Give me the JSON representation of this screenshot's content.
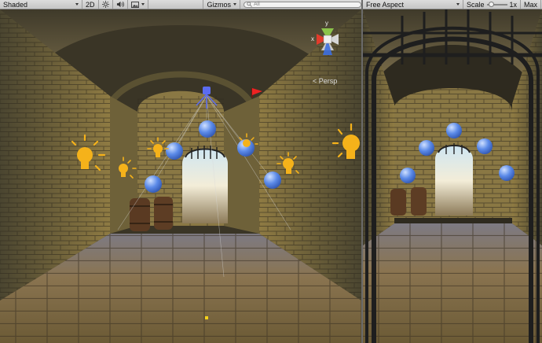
{
  "scene_toolbar": {
    "shading_mode": "Shaded",
    "mode_2d": "2D",
    "light_icon": "sun-icon",
    "audio_icon": "speaker-icon",
    "effects_icon": "image-icon",
    "gizmos_label": "Gizmos",
    "search_placeholder": "All"
  },
  "scene_view": {
    "projection_label": "< Persp",
    "gizmo_axes": {
      "x": "x",
      "y": "y"
    }
  },
  "game_toolbar": {
    "aspect": "Free Aspect",
    "scale_label": "Scale",
    "scale_value": "1x",
    "maximize_label": "Max"
  },
  "colors": {
    "toolbar_bg": "#d4d4d4",
    "light_icon": "#f5b21a",
    "probe_sphere": "#4d7fe0",
    "axis_x": "#e23b2b",
    "axis_y": "#8bc34a",
    "axis_z": "#3d6fe0"
  }
}
